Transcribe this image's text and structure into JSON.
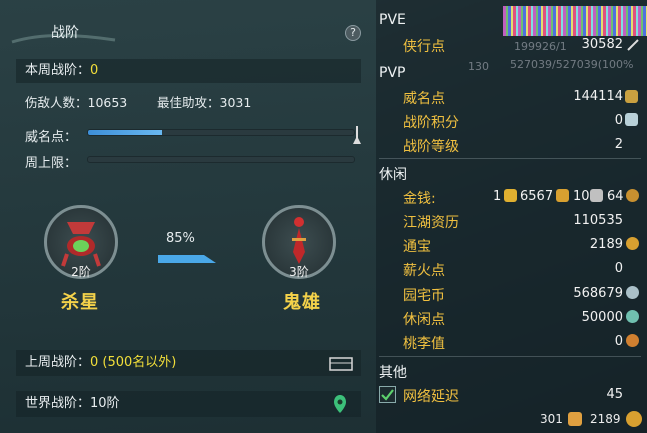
{
  "left": {
    "title": "战阶",
    "help_label": "?",
    "weekly_label": "本周战阶：",
    "weekly_value": "0",
    "damage_label": "伤敌人数：10653",
    "assist_label": "最佳助攻：3031",
    "prestige_label": "威名点：",
    "prestige_fill": 0.28,
    "weekly_cap_label": "周上限：",
    "weekly_cap_fill": 0,
    "current": {
      "tier": "2阶",
      "name": "杀星"
    },
    "next": {
      "tier": "3阶",
      "name": "鬼雄"
    },
    "progress_pct": "85%",
    "last_week_label": "上周战阶：",
    "last_week_value": "0 (500名以外)",
    "world_label": "世界战阶：10阶"
  },
  "right": {
    "pve": {
      "header": "PVE",
      "items": [
        {
          "label": "侠行点",
          "value": "30582"
        }
      ]
    },
    "pvp": {
      "header": "PVP",
      "items": [
        {
          "label": "威名点",
          "value": "144114"
        },
        {
          "label": "战阶积分",
          "value": "0"
        },
        {
          "label": "战阶等级",
          "value": "2"
        }
      ]
    },
    "leisure": {
      "header": "休闲",
      "money_label": "金钱:",
      "money_gold": "1",
      "money_silver": "6567",
      "money_copper": "10",
      "money_other": "64",
      "items": [
        {
          "label": "江湖资历",
          "value": "110535"
        },
        {
          "label": "通宝",
          "value": "2189"
        },
        {
          "label": "薪火点",
          "value": "0"
        },
        {
          "label": "园宅币",
          "value": "568679"
        },
        {
          "label": "休闲点",
          "value": "50000"
        },
        {
          "label": "桃李值",
          "value": "0"
        }
      ]
    },
    "other": {
      "header": "其他",
      "latency_label": "网络延迟",
      "latency_value": "45"
    },
    "footer": {
      "left_value": "301",
      "right_value": "2189"
    },
    "ghost": {
      "hp1": "199926/1",
      "mp": "527039/527039(100%",
      "lvl": "130"
    }
  },
  "colors": {
    "accent_yellow": "#f2df3a",
    "label_gold": "#f0c040",
    "bar_blue": "#3d8fd8"
  }
}
